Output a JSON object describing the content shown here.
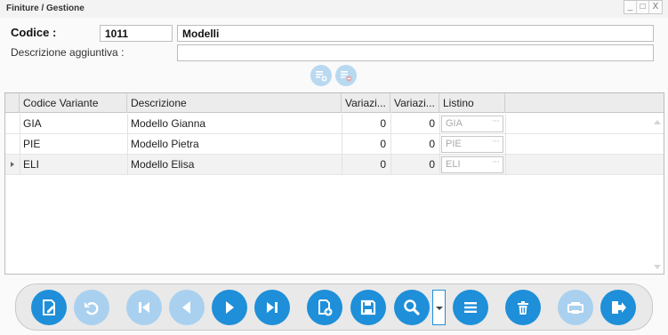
{
  "window": {
    "title": "Finiture / Gestione",
    "minimize": "_",
    "restore": "□",
    "close": "X"
  },
  "form": {
    "codice_label": "Codice :",
    "codice_value": "1011",
    "nome_value": "Modelli",
    "descrizione_label": "Descrizione aggiuntiva :",
    "descrizione_value": ""
  },
  "mini_buttons": [
    "add-row-icon",
    "remove-row-icon"
  ],
  "grid": {
    "columns": [
      "Codice Variante",
      "Descrizione",
      "Variazi...",
      "Variazi...",
      "Listino"
    ],
    "rows": [
      {
        "codice": "GIA",
        "descrizione": "Modello Gianna",
        "var1": "0",
        "var2": "0",
        "listino": "GIA",
        "selected": false
      },
      {
        "codice": "PIE",
        "descrizione": "Modello Pietra",
        "var1": "0",
        "var2": "0",
        "listino": "PIE",
        "selected": false
      },
      {
        "codice": "ELI",
        "descrizione": "Modello Elisa",
        "var1": "0",
        "var2": "0",
        "listino": "ELI",
        "selected": true
      }
    ],
    "lookup_dots": "···"
  },
  "toolbar": {
    "buttons": [
      {
        "name": "edit-button",
        "icon": "edit-document-icon",
        "enabled": true
      },
      {
        "name": "undo-button",
        "icon": "undo-icon",
        "enabled": false
      },
      {
        "name": "first-record-button",
        "icon": "skip-first-icon",
        "enabled": false
      },
      {
        "name": "previous-record-button",
        "icon": "previous-icon",
        "enabled": false
      },
      {
        "name": "next-record-button",
        "icon": "next-icon",
        "enabled": true
      },
      {
        "name": "last-record-button",
        "icon": "skip-last-icon",
        "enabled": true
      },
      {
        "name": "new-record-button",
        "icon": "new-document-icon",
        "enabled": true
      },
      {
        "name": "save-button",
        "icon": "save-icon",
        "enabled": true
      },
      {
        "name": "search-button",
        "icon": "search-icon",
        "enabled": true
      },
      {
        "name": "list-button",
        "icon": "list-icon",
        "enabled": true
      },
      {
        "name": "delete-button",
        "icon": "trash-icon",
        "enabled": true
      },
      {
        "name": "print-button",
        "icon": "print-icon",
        "enabled": false
      },
      {
        "name": "exit-button",
        "icon": "exit-icon",
        "enabled": true
      }
    ]
  },
  "colors": {
    "accent": "#1e8fd8",
    "accent_disabled": "#a9d1ef",
    "toolbar_bg": "#e9e9e9"
  }
}
